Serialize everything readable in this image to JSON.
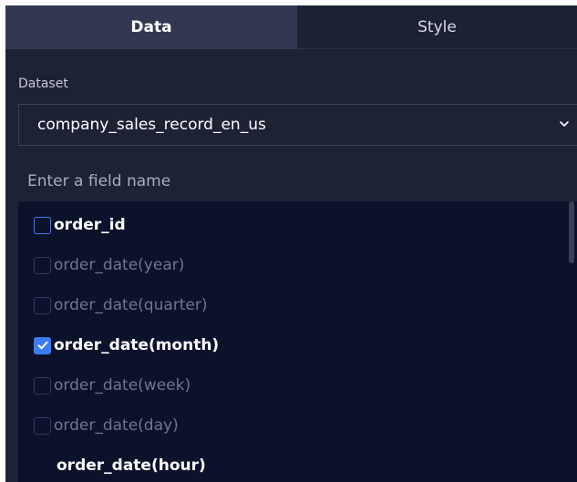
{
  "tabs": [
    {
      "label": "Data",
      "active": true
    },
    {
      "label": "Style",
      "active": false
    }
  ],
  "dataset": {
    "label": "Dataset",
    "value": "company_sales_record_en_us",
    "icon": "chevron-down-icon"
  },
  "search": {
    "placeholder": "Enter a field name",
    "value": ""
  },
  "fields": [
    {
      "label": "order_id",
      "checked": false,
      "enabled": true
    },
    {
      "label": "order_date(year)",
      "checked": false,
      "enabled": false
    },
    {
      "label": "order_date(quarter)",
      "checked": false,
      "enabled": false
    },
    {
      "label": "order_date(month)",
      "checked": true,
      "enabled": true
    },
    {
      "label": "order_date(week)",
      "checked": false,
      "enabled": false
    },
    {
      "label": "order_date(day)",
      "checked": false,
      "enabled": false
    },
    {
      "label": "order_date(hour)",
      "checked": false,
      "enabled": true
    }
  ],
  "colors": {
    "panel_bg": "#1e2235",
    "active_tab_bg": "#323851",
    "list_bg": "#0d122c",
    "accent": "#3a7df5",
    "disabled_text": "#6f7591"
  }
}
